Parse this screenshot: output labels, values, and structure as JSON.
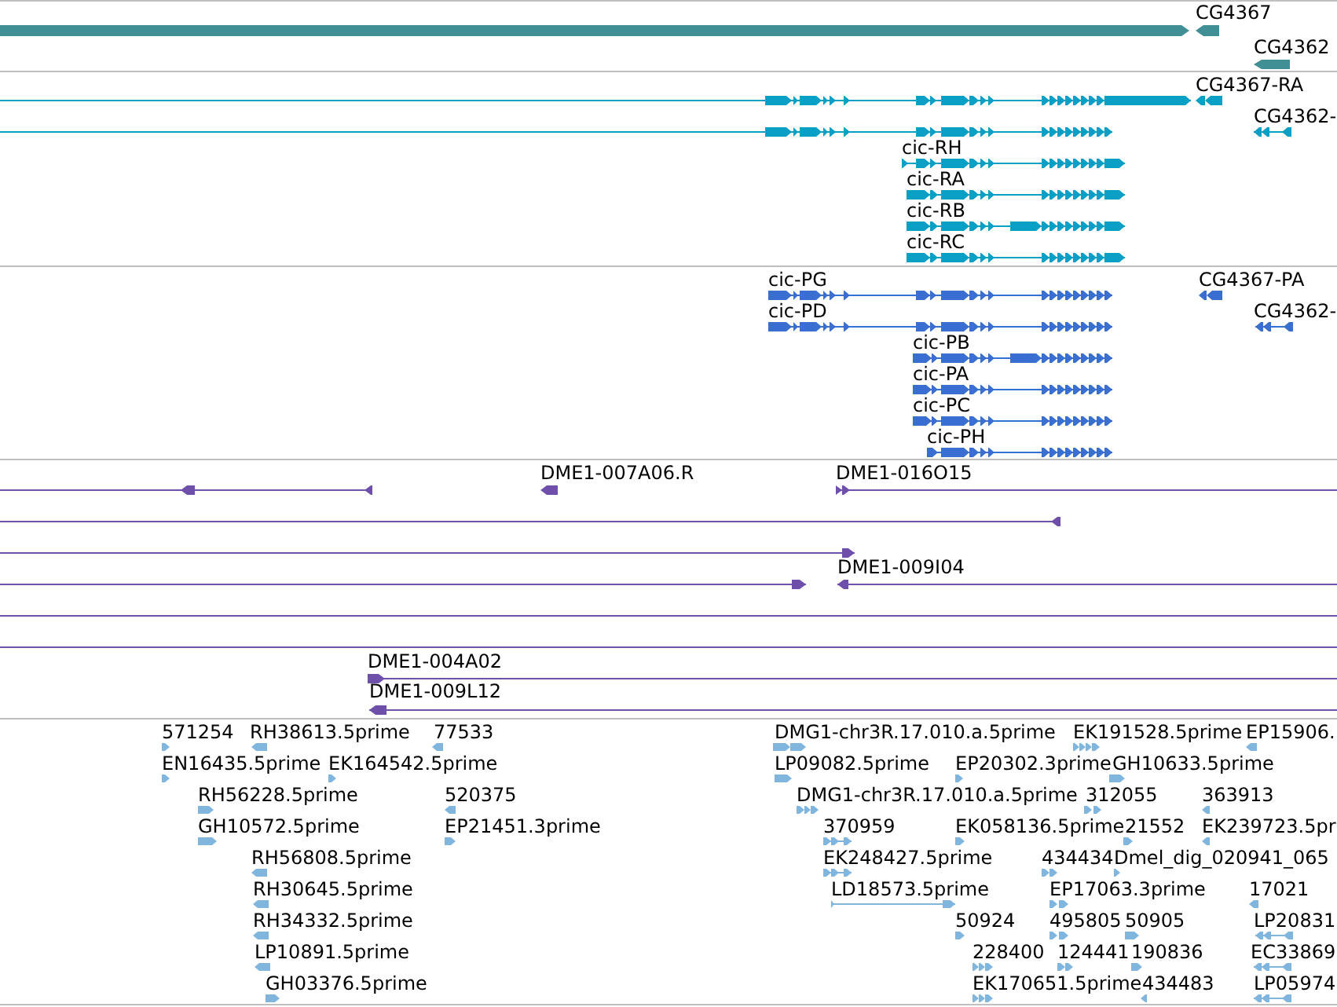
{
  "tracks": [
    {
      "kind": "gene",
      "features": [
        {
          "reverse": false
        },
        {
          "label": "CG4367",
          "reverse": true
        },
        {
          "label": "CG4362",
          "reverse": true
        }
      ]
    },
    {
      "kind": "transcript",
      "features": [
        {
          "reverse": false
        },
        {
          "label": "CG4367-RA",
          "reverse": true
        },
        {
          "reverse": false
        },
        {
          "label": "CG4362-",
          "reverse": true
        },
        {
          "label": "cic-RH",
          "reverse": false
        },
        {
          "label": "cic-RA",
          "reverse": false
        },
        {
          "label": "cic-RB",
          "reverse": false
        },
        {
          "label": "cic-RC",
          "reverse": false
        }
      ]
    },
    {
      "kind": "protein",
      "features": [
        {
          "label": "cic-PG",
          "reverse": false
        },
        {
          "label": "CG4367-PA",
          "reverse": true
        },
        {
          "label": "cic-PD",
          "reverse": false
        },
        {
          "label": "CG4362-",
          "reverse": true
        },
        {
          "label": "cic-PB",
          "reverse": false
        },
        {
          "label": "cic-PA",
          "reverse": false
        },
        {
          "label": "cic-PC",
          "reverse": false
        },
        {
          "label": "cic-PH",
          "reverse": false
        }
      ]
    },
    {
      "kind": "clone",
      "features": [
        {
          "kind": "read",
          "reverse": true
        },
        {
          "kind": "read",
          "label": "DME1-007A06.R",
          "reverse": true
        },
        {
          "kind": "read",
          "label": "DME1-016O15",
          "reverse": false
        },
        {
          "kind": "read",
          "reverse": true
        },
        {
          "kind": "read",
          "reverse": false
        },
        {
          "kind": "read",
          "reverse": false
        },
        {
          "kind": "read",
          "label": "DME1-009I04",
          "reverse": true
        },
        {
          "kind": "line"
        },
        {
          "kind": "line"
        },
        {
          "kind": "read",
          "label": "DME1-004A02",
          "reverse": false
        },
        {
          "kind": "read",
          "label": "DME1-009L12",
          "reverse": true
        }
      ]
    },
    {
      "kind": "est",
      "features": [
        {
          "label": "571254",
          "reverse": false
        },
        {
          "label": "RH38613.5prime",
          "reverse": true
        },
        {
          "label": "77533",
          "reverse": true
        },
        {
          "label": "DMG1-chr3R.17.010.a.5prime",
          "reverse": false
        },
        {
          "label": "EK191528.5prime",
          "reverse": false
        },
        {
          "label": "EP15906.",
          "reverse": true
        },
        {
          "label": "EN16435.5prime",
          "reverse": false
        },
        {
          "label": "EK164542.5prime",
          "reverse": false
        },
        {
          "label": "LP09082.5prime",
          "reverse": false
        },
        {
          "label": "EP20302.3prime",
          "reverse": false
        },
        {
          "label": "GH10633.5prime",
          "reverse": false
        },
        {
          "label": "RH56228.5prime",
          "reverse": false
        },
        {
          "label": "520375",
          "reverse": true
        },
        {
          "label": "DMG1-chr3R.17.010.a.5prime",
          "reverse": false
        },
        {
          "label": "312055",
          "reverse": false
        },
        {
          "label": "363913",
          "reverse": true
        },
        {
          "label": "GH10572.5prime",
          "reverse": false
        },
        {
          "label": "EP21451.3prime",
          "reverse": false
        },
        {
          "label": "370959",
          "reverse": false
        },
        {
          "label": "EK058136.5prime",
          "reverse": false
        },
        {
          "label": "21552",
          "reverse": false
        },
        {
          "label": "EK239723.5pr",
          "reverse": true
        },
        {
          "label": "RH56808.5prime",
          "reverse": true
        },
        {
          "label": "EK248427.5prime",
          "reverse": false
        },
        {
          "label": "434434",
          "reverse": false
        },
        {
          "label": "Dmel_dig_020941_065",
          "reverse": false
        },
        {
          "label": "RH30645.5prime",
          "reverse": true
        },
        {
          "label": "LD18573.5prime",
          "reverse": false
        },
        {
          "label": "EP17063.3prime",
          "reverse": false
        },
        {
          "label": "17021",
          "reverse": true
        },
        {
          "label": "RH34332.5prime",
          "reverse": true
        },
        {
          "label": "50924",
          "reverse": false
        },
        {
          "label": "495805",
          "reverse": false
        },
        {
          "label": "50905",
          "reverse": false
        },
        {
          "label": "LP20831",
          "reverse": true
        },
        {
          "label": "LP10891.5prime",
          "reverse": true
        },
        {
          "label": "228400",
          "reverse": false
        },
        {
          "label": "124441",
          "reverse": false
        },
        {
          "label": "190836",
          "reverse": false
        },
        {
          "label": "EC33869",
          "reverse": true
        },
        {
          "label": "GH03376.5prime",
          "reverse": false
        },
        {
          "label": "EK170651.5prime",
          "reverse": false
        },
        {
          "label": "434483",
          "reverse": true
        },
        {
          "label": "LP05974",
          "reverse": true
        }
      ]
    }
  ]
}
